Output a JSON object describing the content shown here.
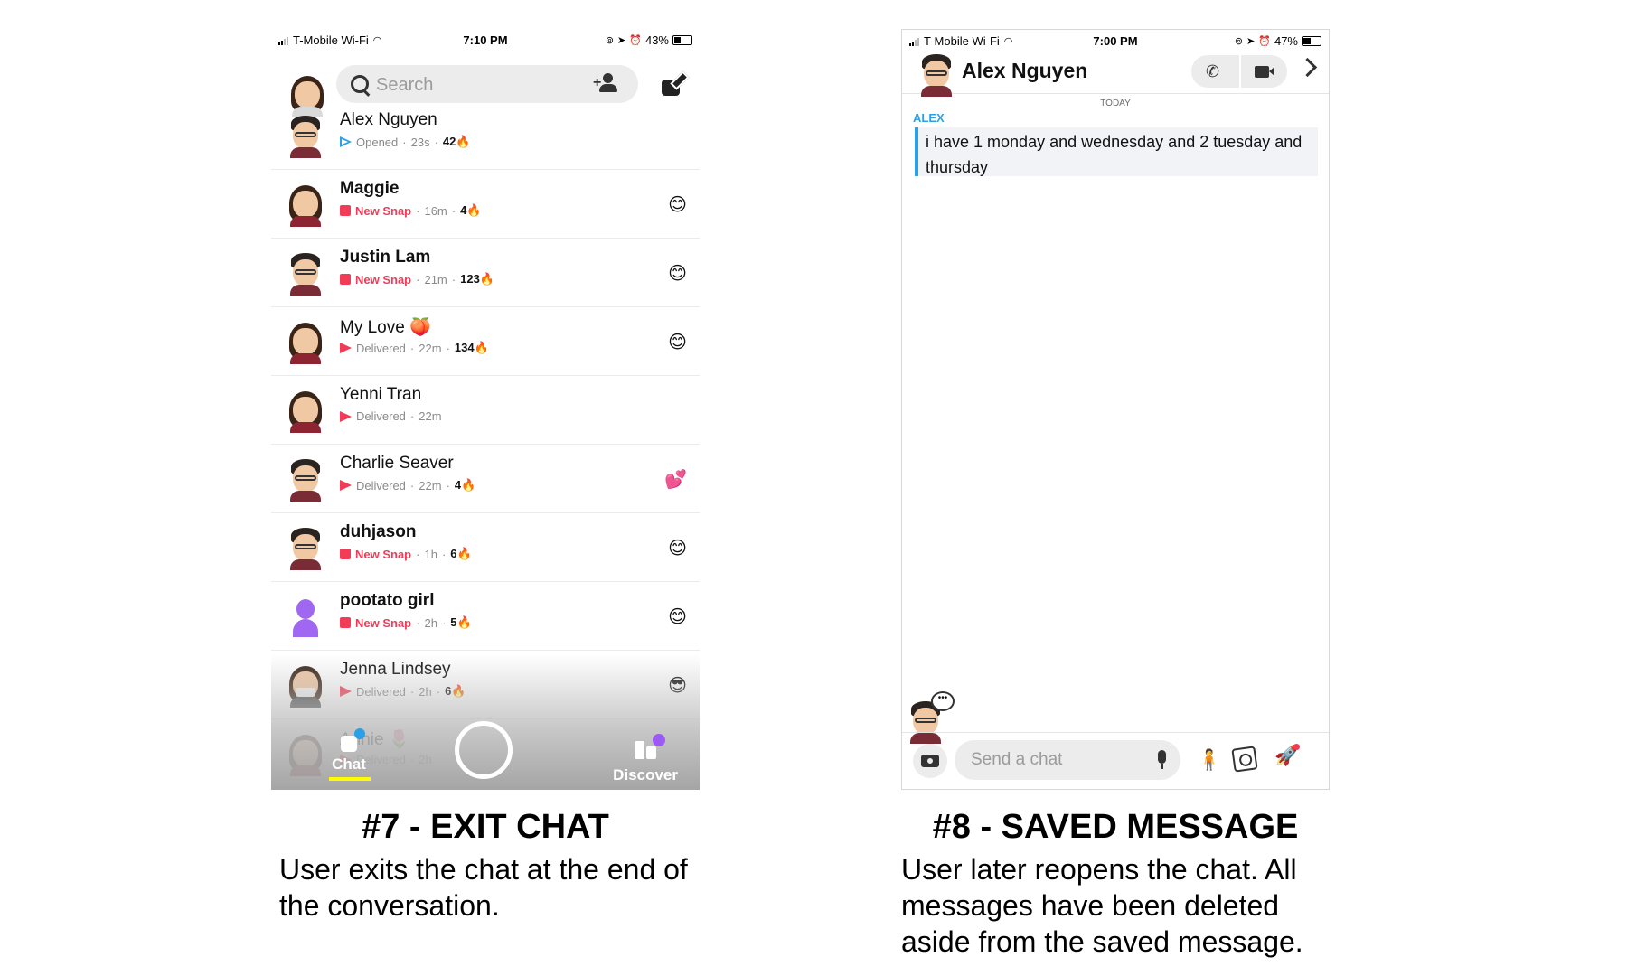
{
  "panel1": {
    "status": {
      "carrier": "T-Mobile Wi-Fi",
      "time": "7:10 PM",
      "battery": "43%",
      "battery_level": 0.43
    },
    "search_placeholder": "Search",
    "chats": [
      {
        "name": "Alex Nguyen",
        "bold": false,
        "status_type": "opened",
        "status": "Opened",
        "time": "23s",
        "streak": "42🔥",
        "emoji": "",
        "avatar": "glasses-boy"
      },
      {
        "name": "Maggie",
        "bold": true,
        "status_type": "new",
        "status": "New Snap",
        "time": "16m",
        "streak": "4🔥",
        "emoji": "😊",
        "avatar": "longhair-girl"
      },
      {
        "name": "Justin Lam",
        "bold": true,
        "status_type": "new",
        "status": "New Snap",
        "time": "21m",
        "streak": "123🔥",
        "emoji": "😊",
        "avatar": "glasses-boy"
      },
      {
        "name": "My Love 🍑",
        "bold": false,
        "status_type": "delivered",
        "status": "Delivered",
        "time": "22m",
        "streak": "134🔥",
        "emoji": "😊",
        "avatar": "longhair-girl"
      },
      {
        "name": "Yenni Tran",
        "bold": false,
        "status_type": "delivered",
        "status": "Delivered",
        "time": "22m",
        "streak": "",
        "emoji": "",
        "avatar": "longhair-girl"
      },
      {
        "name": "Charlie Seaver",
        "bold": false,
        "status_type": "delivered",
        "status": "Delivered",
        "time": "22m",
        "streak": "4🔥",
        "emoji": "💕",
        "avatar": "glasses-boy"
      },
      {
        "name": "duhjason",
        "bold": true,
        "status_type": "new",
        "status": "New Snap",
        "time": "1h",
        "streak": "6🔥",
        "emoji": "😊",
        "avatar": "glasses-boy"
      },
      {
        "name": "pootato girl",
        "bold": true,
        "status_type": "new",
        "status": "New Snap",
        "time": "2h",
        "streak": "5🔥",
        "emoji": "😊",
        "avatar": "ghost"
      },
      {
        "name": "Jenna Lindsey",
        "bold": false,
        "status_type": "delivered",
        "status": "Delivered",
        "time": "2h",
        "streak": "6🔥",
        "emoji": "😎",
        "avatar": "mask-girl"
      },
      {
        "name": "Annie 🌷",
        "bold": false,
        "status_type": "delivered",
        "status": "Delivered",
        "time": "2h",
        "streak": "",
        "emoji": "",
        "avatar": "longhair-girl"
      }
    ],
    "nav": {
      "chat": "Chat",
      "discover": "Discover"
    }
  },
  "panel2": {
    "status": {
      "carrier": "T-Mobile Wi-Fi",
      "time": "7:00 PM",
      "battery": "47%",
      "battery_level": 0.47
    },
    "title": "Alex Nguyen",
    "day": "TODAY",
    "sender": "ALEX",
    "message": "i have 1 monday and wednesday and 2 tuesday and thursday",
    "input_placeholder": "Send a chat"
  },
  "captions": {
    "left_title": "#7 - EXIT CHAT",
    "left_desc": "User exits the chat at the end of the conversation.",
    "right_title": "#8 - SAVED MESSAGE",
    "right_desc": "User later reopens the chat. All messages have been deleted aside from the saved message."
  },
  "colors": {
    "snap_red": "#f23c57",
    "chat_blue": "#2aa0e6",
    "snap_yellow": "#fffc00",
    "discover_purple": "#9b59f5"
  }
}
